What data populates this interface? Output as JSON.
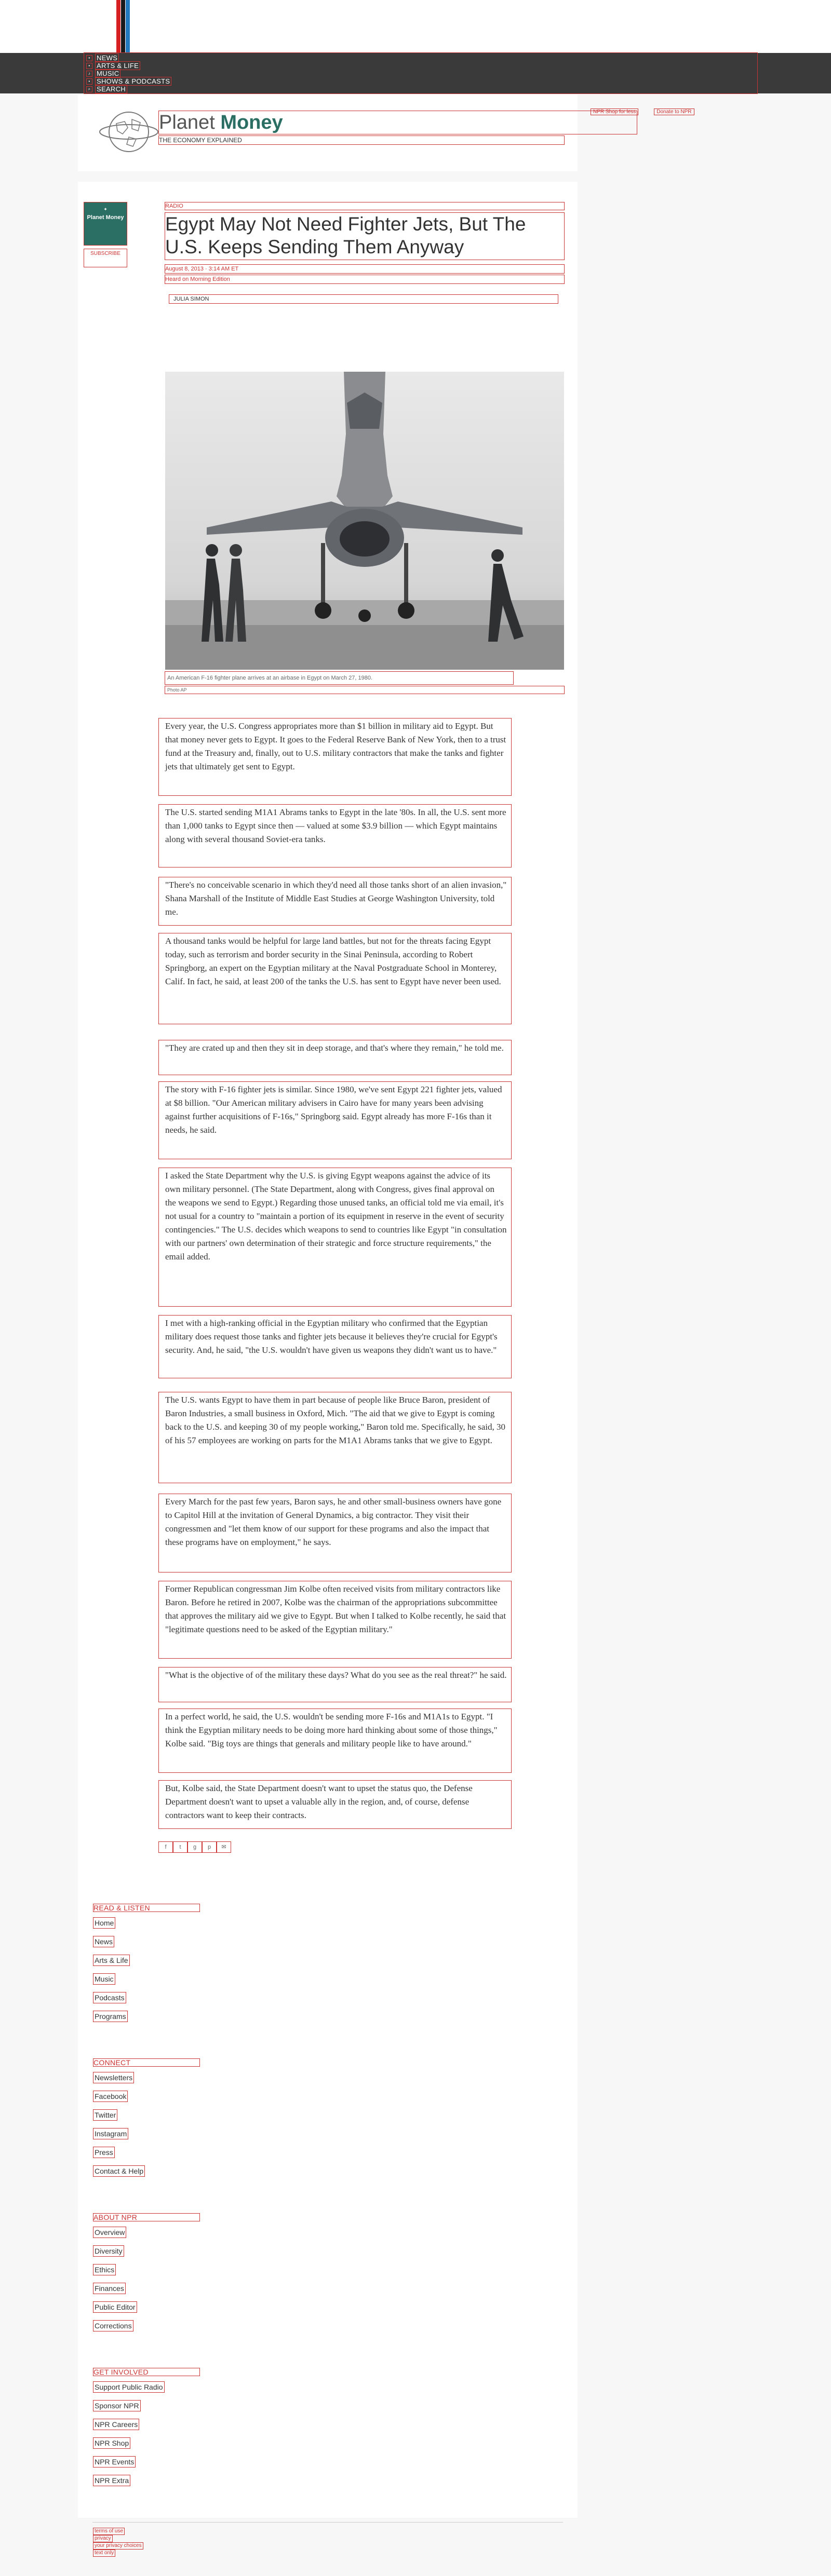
{
  "nav": {
    "items": [
      {
        "label": "News"
      },
      {
        "label": "Arts & Life"
      },
      {
        "label": "Music"
      },
      {
        "label": "Shows & Podcasts"
      },
      {
        "label": "Search"
      }
    ]
  },
  "blog": {
    "title_part1": "Planet ",
    "title_part2": "Money",
    "tagline": "THE ECONOMY EXPLAINED",
    "side_logo": "Planet Money",
    "subscribe": "SUBSCRIBE",
    "top_links": [
      "NPR Shop for less",
      "Donate to NPR"
    ]
  },
  "article": {
    "slug": "RADIO",
    "headline": "Egypt May Not Need Fighter Jets, But The U.S. Keeps Sending Them Anyway",
    "date": "August 8, 2013 · 3:14 AM ET",
    "heard_on": "Heard on Morning Edition",
    "byline": "JULIA SIMON",
    "caption": "An American F-16 fighter plane arrives at an airbase in Egypt on March 27, 1980.",
    "credit": "Photo AP",
    "paragraphs": [
      "Every year, the U.S. Congress appropriates more than $1 billion in military aid to Egypt. But that money never gets to Egypt. It goes to the Federal Reserve Bank of New York, then to a trust fund at the Treasury and, finally, out to U.S. military contractors that make the tanks and fighter jets that ultimately get sent to Egypt.",
      "The U.S. started sending M1A1 Abrams tanks to Egypt in the late '80s. In all, the U.S. sent more than 1,000 tanks to Egypt since then — valued at some $3.9 billion — which Egypt maintains along with several thousand Soviet-era tanks.",
      "\"There's no conceivable scenario in which they'd need all those tanks short of an alien invasion,\" Shana Marshall of the Institute of Middle East Studies at George Washington University, told me.",
      "A thousand tanks would be helpful for large land battles, but not for the threats facing Egypt today, such as terrorism and border security in the Sinai Peninsula, according to Robert Springborg, an expert on the Egyptian military at the Naval Postgraduate School in Monterey, Calif. In fact, he said, at least 200 of the tanks the U.S. has sent to Egypt have never been used.",
      "\"They are crated up and then they sit in deep storage, and that's where they remain,\" he told me.",
      "The story with F-16 fighter jets is similar. Since 1980, we've sent Egypt 221 fighter jets, valued at $8 billion. \"Our American military advisers in Cairo have for many years been advising against further acquisitions of F-16s,\" Springborg said. Egypt already has more F-16s than it needs, he said.",
      "I asked the State Department why the U.S. is giving Egypt weapons against the advice of its own military personnel. (The State Department, along with Congress, gives final approval on the weapons we send to Egypt.) Regarding those unused tanks, an official told me via email, it's not usual for a country to \"maintain a portion of its equipment in reserve in the event of security contingencies.\" The U.S. decides which weapons to send to countries like Egypt \"in consultation with our partners' own determination of their strategic and force structure requirements,\" the email added.",
      "I met with a high-ranking official in the Egyptian military who confirmed that the Egyptian military does request those tanks and fighter jets because it believes they're crucial for Egypt's security. And, he said, \"the U.S. wouldn't have given us weapons they didn't want us to have.\"",
      "The U.S. wants Egypt to have them in part because of people like Bruce Baron, president of Baron Industries, a small business in Oxford, Mich. \"The aid that we give to Egypt is coming back to the U.S. and keeping 30 of my people working,\" Baron told me. Specifically, he said, 30 of his 57 employees are working on parts for the M1A1 Abrams tanks that we give to Egypt.",
      "Every March for the past few years, Baron says, he and other small-business owners have gone to Capitol Hill at the invitation of General Dynamics, a big contractor. They visit their congressmen and \"let them know of our support for these programs and also the impact that these programs have on employment,\" he says.",
      "Former Republican congressman Jim Kolbe often received visits from military contractors like Baron. Before he retired in 2007, Kolbe was the chairman of the appropriations subcommittee that approves the military aid we give to Egypt. But when I talked to Kolbe recently, he said that \"legitimate questions need to be asked of the Egyptian military.\"",
      "\"What is the objective of of the military these days? What do you see as the real threat?\" he said.",
      "In a perfect world, he said, the U.S. wouldn't be sending more F-16s and M1A1s to Egypt. \"I think the Egyptian military needs to be doing more hard thinking about some of those things,\" Kolbe said. \"Big toys are things that generals and military people like to have around.\"",
      "But, Kolbe said, the State Department doesn't want to upset the status quo, the Defense Department doesn't want to upset a valuable ally in the region, and, of course, defense contractors want to keep their contracts."
    ],
    "share": [
      "f",
      "t",
      "g",
      "p",
      "✉"
    ]
  },
  "footer": {
    "sections": [
      {
        "heading": "Read & Listen",
        "links": [
          "Home",
          "News",
          "Arts & Life",
          "Music",
          "Podcasts",
          "Programs"
        ]
      },
      {
        "heading": "Connect",
        "links": [
          "Newsletters",
          "Facebook",
          "Twitter",
          "Instagram",
          "Press",
          "Contact & Help"
        ]
      },
      {
        "heading": "About NPR",
        "links": [
          "Overview",
          "Diversity",
          "Ethics",
          "Finances",
          "Public Editor",
          "Corrections"
        ]
      },
      {
        "heading": "Get Involved",
        "links": [
          "Support Public Radio",
          "Sponsor NPR",
          "NPR Careers",
          "NPR Shop",
          "NPR Events",
          "NPR Extra"
        ]
      }
    ],
    "legal": [
      "terms of use",
      "privacy",
      "your privacy choices",
      "text only"
    ]
  }
}
